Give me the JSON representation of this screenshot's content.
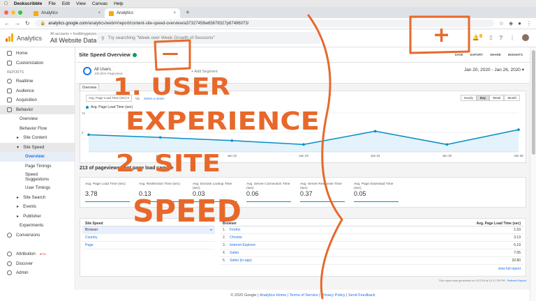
{
  "menubar": {
    "app": "Deskscribble",
    "items": [
      "File",
      "Edit",
      "View",
      "Canvas",
      "Help"
    ]
  },
  "browser": {
    "tabs": [
      {
        "label": "Analytics",
        "active": false
      },
      {
        "label": "Analytics",
        "active": true
      }
    ],
    "url_host": "analytics.google.com",
    "url_path": "/analytics/web/#/report/content-site-speed-overview/a37327458w65678327p67496073/"
  },
  "ga": {
    "title": "Analytics",
    "account_crumb": "All accounts > foodbloggerpro.com",
    "view": "All Website Data",
    "search_placeholder": "Try searching \"Week over Week Growth of Sessions\"",
    "notif_count": "1"
  },
  "sidebar": {
    "top": [
      {
        "label": "Home"
      },
      {
        "label": "Customization"
      }
    ],
    "section_label": "REPORTS",
    "reports": [
      {
        "label": "Realtime"
      },
      {
        "label": "Audience"
      },
      {
        "label": "Acquisition"
      },
      {
        "label": "Behavior"
      }
    ],
    "behavior": [
      "Overview",
      "Behavior Flow",
      "Site Content",
      "Site Speed"
    ],
    "site_speed": [
      "Overview",
      "Page Timings",
      "Speed Suggestions",
      "User Timings"
    ],
    "behavior_after": [
      "Site Search",
      "Events",
      "Publisher",
      "Experiments"
    ],
    "conversions": "Conversions",
    "bottom": [
      "Attribution",
      "Discover",
      "Admin"
    ],
    "beta": "BETA"
  },
  "page": {
    "title": "Site Speed Overview",
    "actions": [
      "SAVE",
      "EXPORT",
      "SHARE",
      "INSIGHTS"
    ],
    "segment_name": "All Users",
    "segment_sub": "100.00% Pageviews",
    "add_segment": "+ Add Segment",
    "date_range": "Jan 20, 2020 - Jan 26, 2020",
    "tab": "Overview",
    "metric_select": "Avg. Page Load Time (sec)",
    "vs": "VS.",
    "select_metric": "Select a metric",
    "granularity": [
      "Hourly",
      "Day",
      "Week",
      "Month"
    ],
    "summary": "213 of pageviews sent page load sample"
  },
  "chart_data": {
    "type": "line",
    "series": [
      {
        "name": "Avg. Page Load Time (sec)",
        "values": [
          4.4,
          3.7,
          2.9,
          1.9,
          5.3,
          1.9,
          5.7
        ]
      }
    ],
    "x": [
      "Jan 20",
      "Jan 21",
      "Jan 22",
      "Jan 23",
      "Jan 24",
      "Jan 25",
      "Jan 26"
    ],
    "xticks": [
      "Jan 21",
      "Jan 22",
      "Jan 23",
      "Jan 24",
      "Jan 25",
      "Jan 26"
    ],
    "yticks": [
      "10",
      "5"
    ],
    "ylim": [
      0,
      10
    ],
    "color": "#058dc7"
  },
  "tiles": [
    {
      "label": "Avg. Page Load Time (sec)",
      "value": "3.78"
    },
    {
      "label": "Avg. Redirection Time (sec)",
      "value": "0.13"
    },
    {
      "label": "Avg. Domain Lookup Time (sec)",
      "value": "0.03"
    },
    {
      "label": "Avg. Server Connection Time (sec)",
      "value": "0.06"
    },
    {
      "label": "Avg. Server Response Time (sec)",
      "value": "0.37"
    },
    {
      "label": "Avg. Page Download Time (sec)",
      "value": "0.05"
    }
  ],
  "left_table": {
    "header": "Site Speed",
    "rows": [
      "Browser",
      "Country",
      "Page"
    ]
  },
  "right_table": {
    "header_left": "Browser",
    "header_right": "Avg. Page Load Time (sec)",
    "rows": [
      {
        "idx": "1.",
        "name": "Firefox",
        "value": "1.53"
      },
      {
        "idx": "2.",
        "name": "Chrome",
        "value": "3.13"
      },
      {
        "idx": "3.",
        "name": "Internet Explorer",
        "value": "5.19"
      },
      {
        "idx": "4.",
        "name": "Safari",
        "value": "7.05"
      },
      {
        "idx": "5.",
        "name": "Safari (in-app)",
        "value": "32.80"
      }
    ],
    "view_full": "view full report"
  },
  "footnote": {
    "text": "This report was generated on 1/27/20 at 12:17:29 PM -",
    "link": "Refresh Report"
  },
  "footer": {
    "copyright": "© 2020 Google",
    "links": [
      "Analytics Home",
      "Terms of Service",
      "Privacy Policy",
      "Send Feedback"
    ],
    "sep": "|"
  },
  "annotations": {
    "color": "#e8682a",
    "plus": "+",
    "minus": "—",
    "line1": "1. USER",
    "line2": "EXPERIENCE",
    "line3": "2. SITE",
    "line4": "SPEED"
  }
}
